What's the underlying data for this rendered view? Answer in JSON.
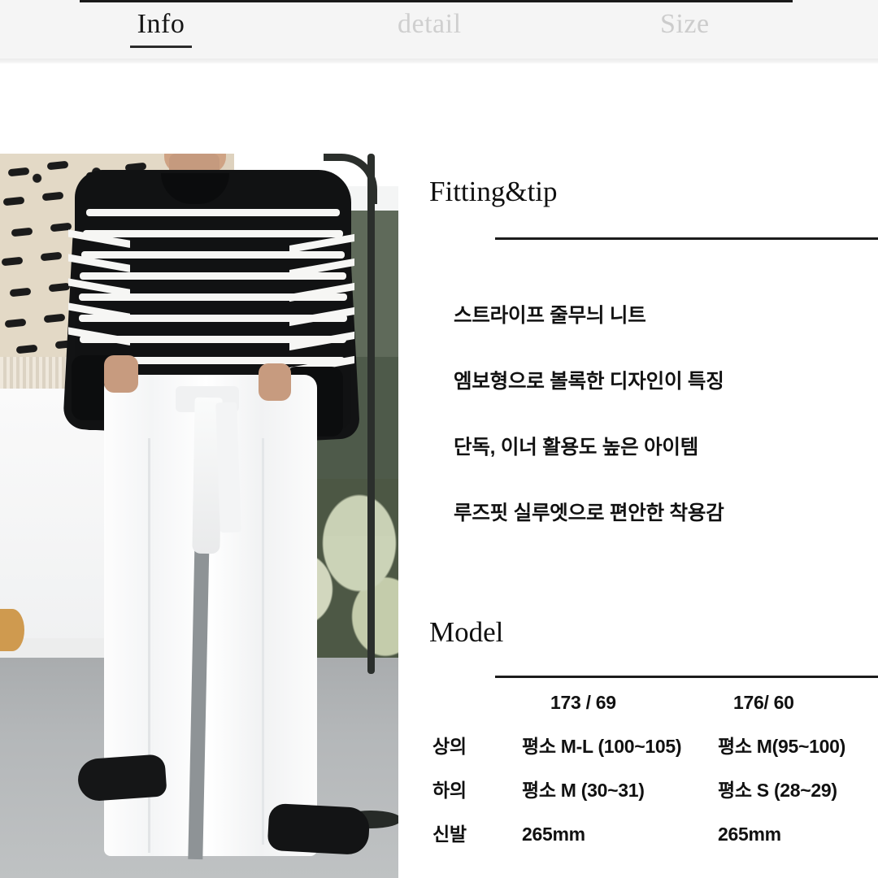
{
  "tabs": [
    {
      "label": "Info",
      "state": "active"
    },
    {
      "label": "detail",
      "state": "inactive"
    },
    {
      "label": "Size",
      "state": "inactive"
    }
  ],
  "colors": {
    "active_tab_text": "#151515",
    "inactive_tab_text": "#cccccc",
    "tabbar_bg": "#f5f5f5",
    "rule": "#1c1c1c",
    "body_text": "#111111"
  },
  "photo": {
    "alt_name": "model-wearing-striped-knit-and-white-wide-pants"
  },
  "sections": {
    "fitting": {
      "heading": "Fitting&tip",
      "bullets": [
        "스트라이프 줄무늬 니트",
        "엠보형으로 볼록한 디자인이 특징",
        "단독, 이너 활용도 높은 아이템",
        "루즈핏 실루엣으로 편안한 착용감"
      ]
    },
    "model": {
      "heading": "Model",
      "columns": [
        "",
        "173 / 69",
        "176/ 60"
      ],
      "rows": [
        {
          "label": "상의",
          "model1": "평소 M-L (100~105)",
          "model2": "평소 M(95~100)"
        },
        {
          "label": "하의",
          "model1": "평소 M (30~31)",
          "model2": "평소 S (28~29)"
        },
        {
          "label": "신발",
          "model1": "265mm",
          "model2": "265mm"
        }
      ]
    }
  }
}
